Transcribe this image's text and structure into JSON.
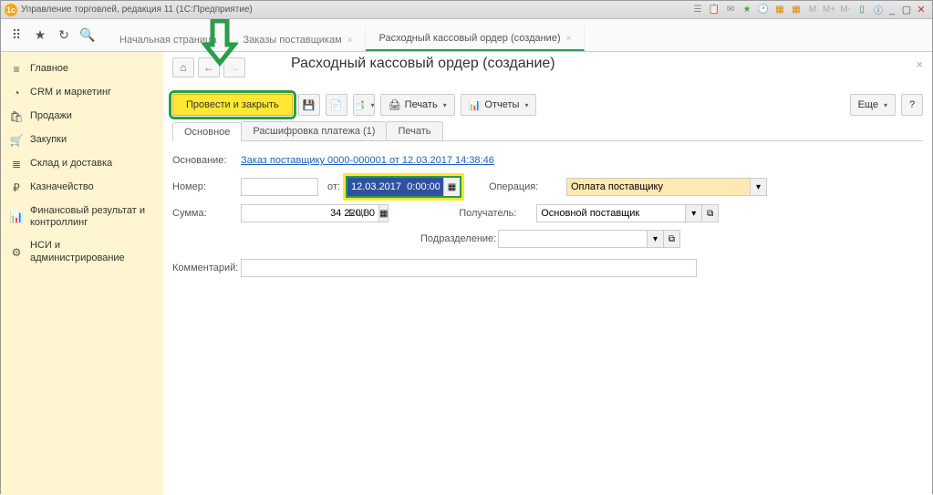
{
  "titlebar": {
    "app_icon": "1c",
    "title": "Управление торговлей, редакция 11   (1С:Предприятие)"
  },
  "tabs": {
    "items": [
      {
        "label": "Начальная страница",
        "active": false
      },
      {
        "label": "Заказы поставщикам",
        "active": false
      },
      {
        "label": "Расходный кассовый ордер (создание)",
        "active": true
      }
    ]
  },
  "sidebar": {
    "items": [
      {
        "icon": "≡",
        "label": "Главное"
      },
      {
        "icon": "◔",
        "label": "CRM и маркетинг"
      },
      {
        "icon": "🛍",
        "label": "Продажи"
      },
      {
        "icon": "🛒",
        "label": "Закупки"
      },
      {
        "icon": "≣",
        "label": "Склад и доставка"
      },
      {
        "icon": "₽",
        "label": "Казначейство"
      },
      {
        "icon": "📊",
        "label": "Финансовый результат и контроллинг"
      },
      {
        "icon": "⚙",
        "label": "НСИ и администрирование"
      }
    ]
  },
  "page": {
    "title": "Расходный кассовый ордер (создание)"
  },
  "toolbar": {
    "primary": "Провести и закрыть",
    "print": "Печать",
    "reports": "Отчеты",
    "more": "Еще"
  },
  "subtabs": {
    "items": [
      {
        "label": "Основное",
        "active": true
      },
      {
        "label": "Расшифровка платежа (1)",
        "active": false
      },
      {
        "label": "Печать",
        "active": false
      }
    ]
  },
  "form": {
    "basis_label": "Основание:",
    "basis_link": "Заказ поставщику 0000-000001 от 12.03.2017 14:38:46",
    "number_label": "Номер:",
    "number_value": "",
    "from_label": "от:",
    "date_value": "12.03.2017  0:00:00",
    "operation_label": "Операция:",
    "operation_value": "Оплата поставщику",
    "sum_label": "Сумма:",
    "sum_value": "34 220,00",
    "currency": "RUB",
    "recipient_label": "Получатель:",
    "recipient_value": "Основной поставщик",
    "department_label": "Подразделение:",
    "department_value": "",
    "comment_label": "Комментарий:",
    "comment_value": ""
  }
}
